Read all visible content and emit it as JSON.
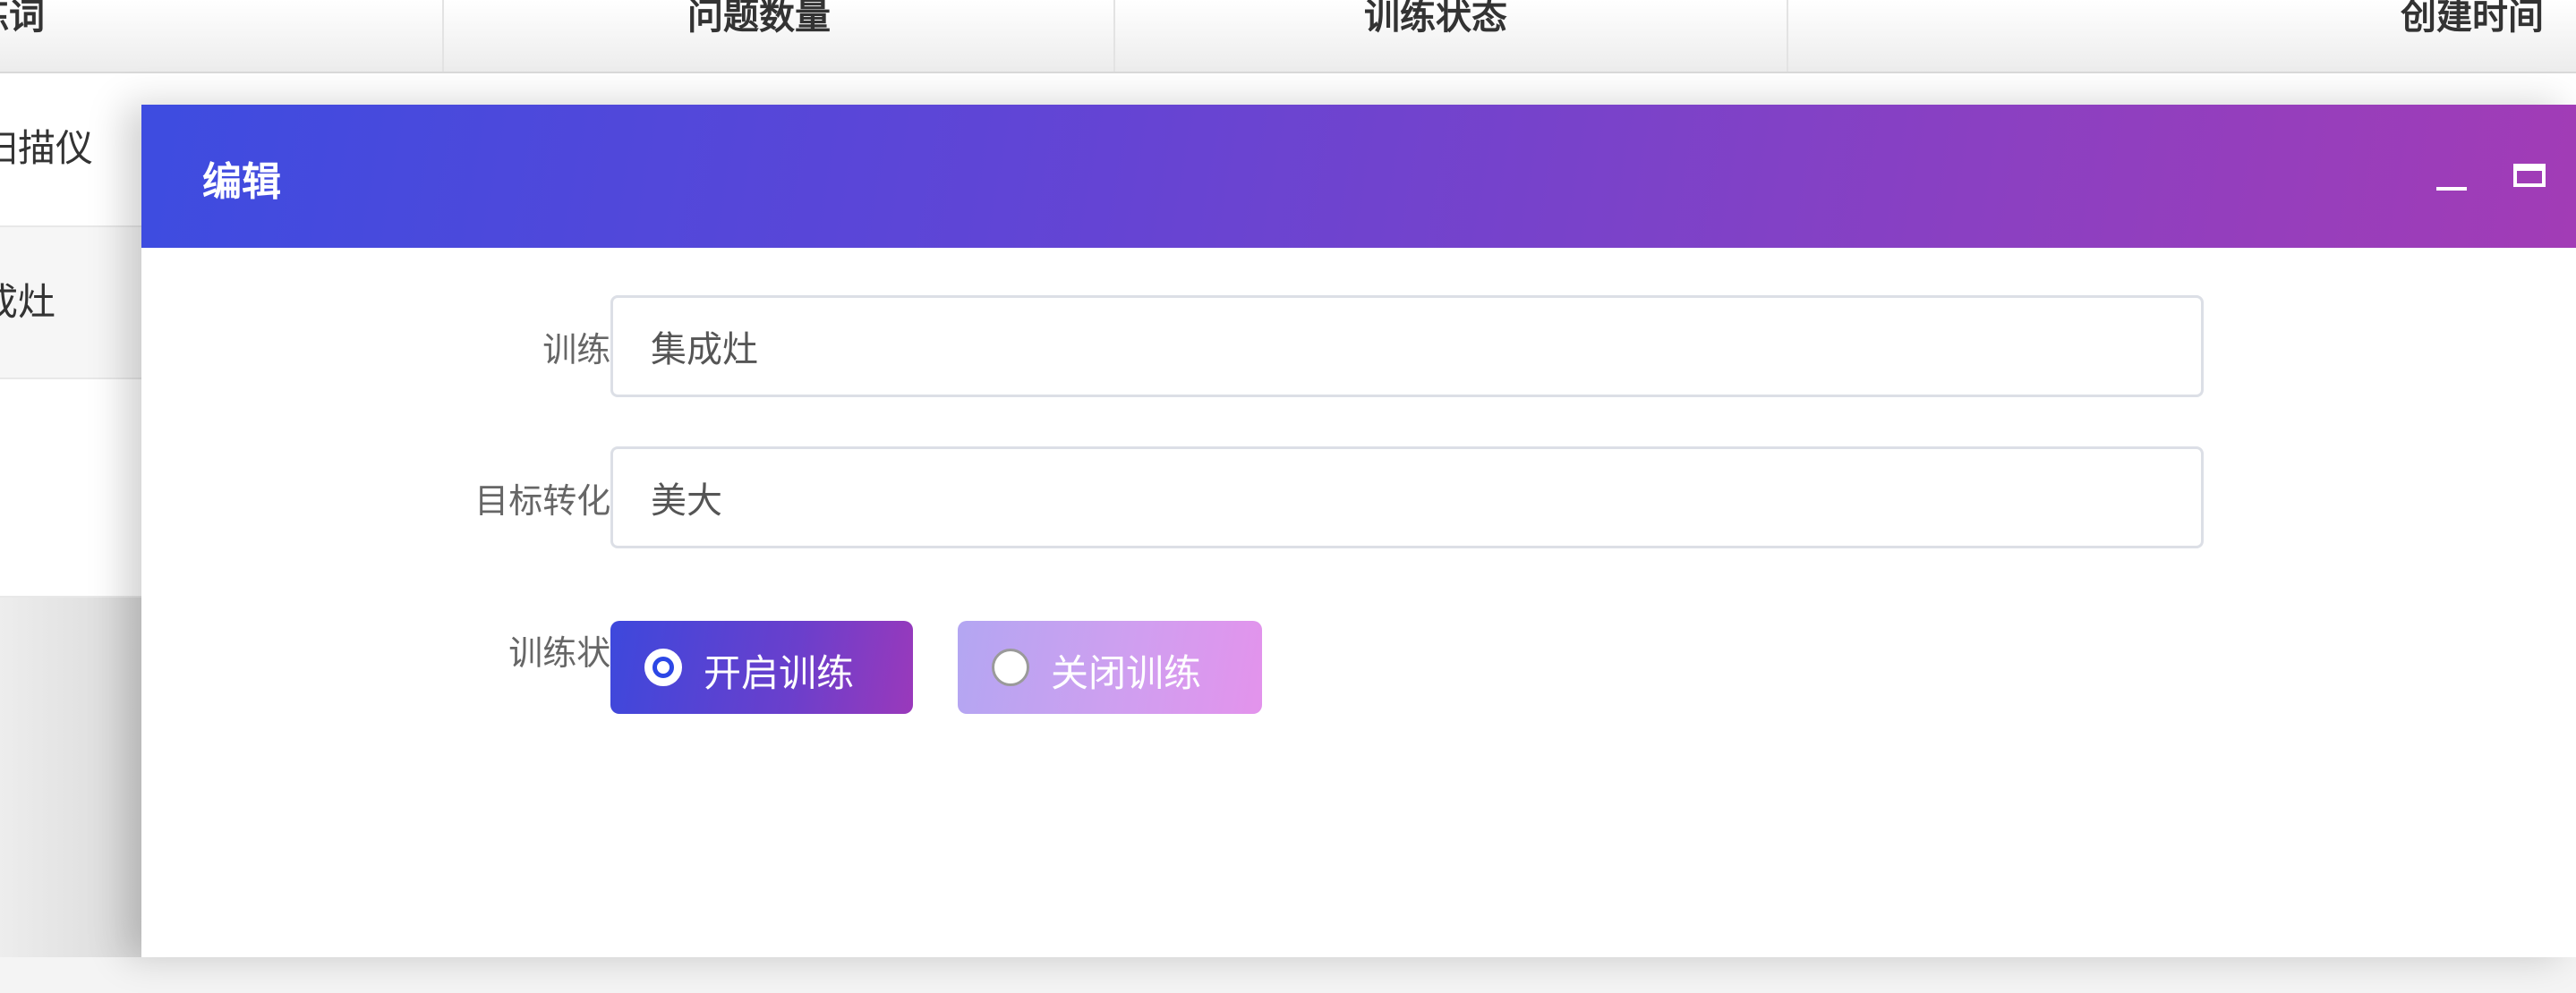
{
  "background_table": {
    "headers": [
      "练词",
      "问题数量",
      "训练状态",
      "创建时间"
    ],
    "rows": [
      "扫描仪",
      "成灶"
    ]
  },
  "dialog": {
    "title": "编辑",
    "controls": {
      "minimize": "minimize-icon",
      "maximize": "maximize-icon"
    }
  },
  "form": {
    "training_word": {
      "label": "训练词:",
      "value": "集成灶"
    },
    "target_word": {
      "label": "目标转化词:",
      "value": "美大"
    },
    "training_status": {
      "label": "训练状态:",
      "options": [
        {
          "label": "开启训练",
          "selected": true
        },
        {
          "label": "关闭训练",
          "selected": false
        }
      ]
    }
  },
  "colors": {
    "title_gradient_start": "#3d4ce0",
    "title_gradient_end": "#a23cb6",
    "radio_selected": "#4a46d8",
    "radio_unselected": "#c9a2f0"
  }
}
